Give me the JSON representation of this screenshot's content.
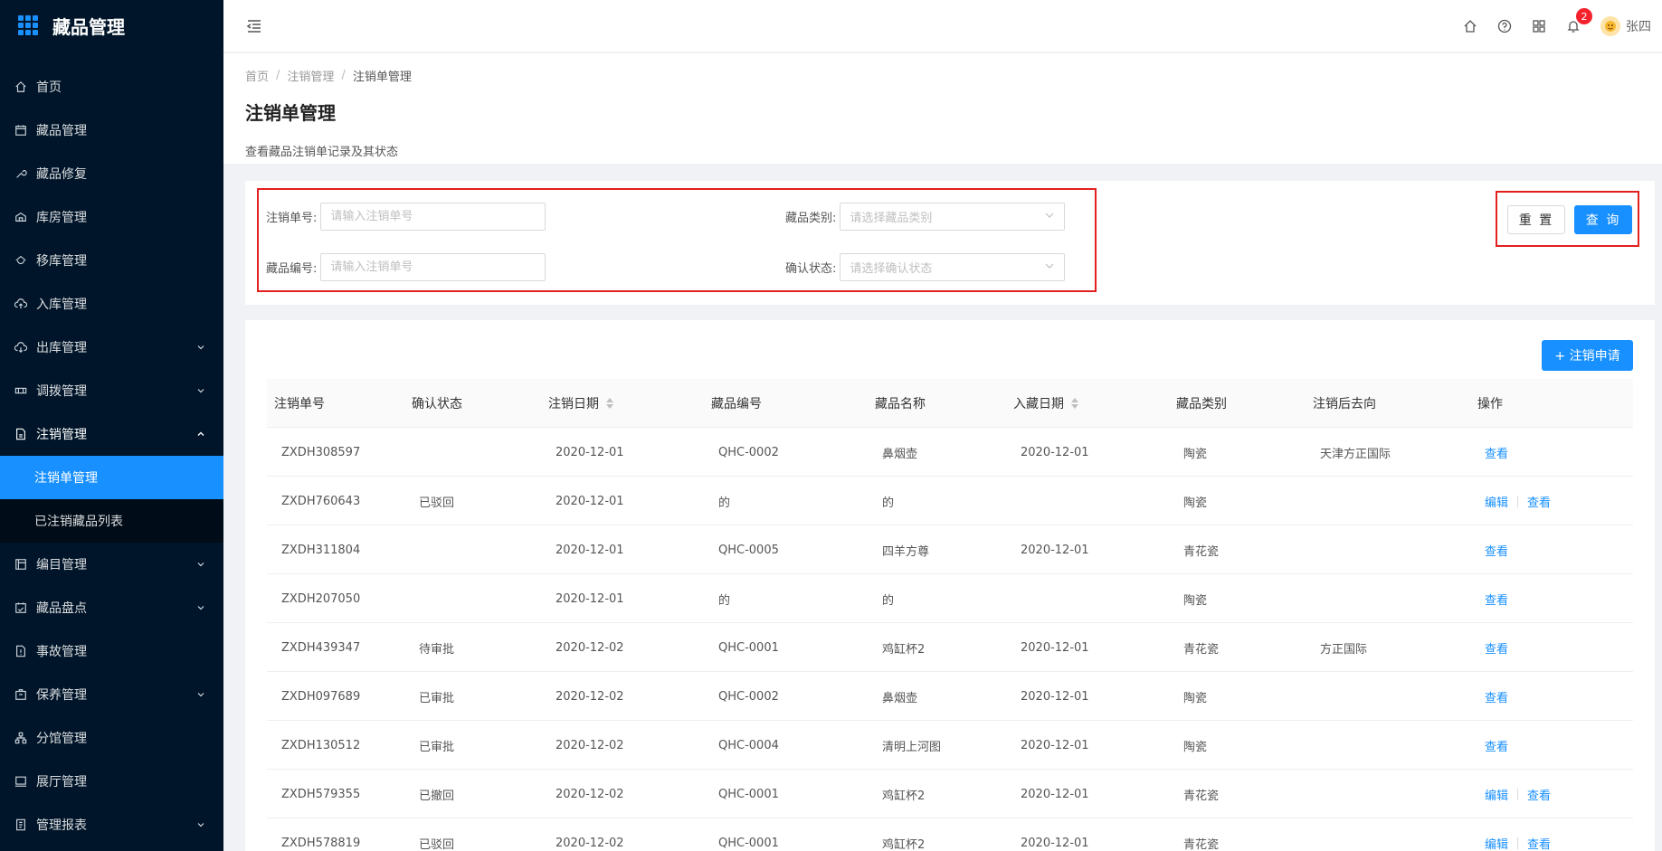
{
  "app": {
    "title": "藏品管理"
  },
  "sidebar": {
    "items": [
      {
        "label": "首页",
        "icon": "home-icon"
      },
      {
        "label": "藏品管理",
        "icon": "calendar-icon"
      },
      {
        "label": "藏品修复",
        "icon": "wrench-icon"
      },
      {
        "label": "库房管理",
        "icon": "warehouse-icon"
      },
      {
        "label": "移库管理",
        "icon": "move-icon"
      },
      {
        "label": "入库管理",
        "icon": "cloud-upload-icon"
      },
      {
        "label": "出库管理",
        "icon": "cloud-download-icon"
      },
      {
        "label": "调拨管理",
        "icon": "transfer-icon"
      },
      {
        "label": "注销管理",
        "icon": "file-icon"
      },
      {
        "label": "注销单管理",
        "icon": ""
      },
      {
        "label": "已注销藏品列表",
        "icon": ""
      },
      {
        "label": "编目管理",
        "icon": "catalog-icon"
      },
      {
        "label": "藏品盘点",
        "icon": "inventory-icon"
      },
      {
        "label": "事故管理",
        "icon": "incident-icon"
      },
      {
        "label": "保养管理",
        "icon": "maintenance-icon"
      },
      {
        "label": "分馆管理",
        "icon": "branch-icon"
      },
      {
        "label": "展厅管理",
        "icon": "monitor-icon"
      },
      {
        "label": "管理报表",
        "icon": "report-icon"
      }
    ]
  },
  "header": {
    "notification_count": "2",
    "user_name": "张四"
  },
  "breadcrumb": [
    "首页",
    "注销管理",
    "注销单管理"
  ],
  "page": {
    "title": "注销单管理",
    "description": "查看藏品注销单记录及其状态"
  },
  "search": {
    "order_no_label": "注销单号:",
    "order_no_placeholder": "请输入注销单号",
    "category_label": "藏品类别:",
    "category_placeholder": "请选择藏品类别",
    "item_no_label": "藏品编号:",
    "item_no_placeholder": "请输入注销单号",
    "status_label": "确认状态:",
    "status_placeholder": "请选择确认状态",
    "reset_label": "重 置",
    "query_label": "查 询"
  },
  "table": {
    "add_label": "+ 注销申请",
    "columns": [
      "注销单号",
      "确认状态",
      "注销日期",
      "藏品编号",
      "藏品名称",
      "入藏日期",
      "藏品类别",
      "注销后去向",
      "操作"
    ],
    "rows": [
      {
        "order_no": "ZXDH308597",
        "status": "",
        "date": "2020-12-01",
        "item_no": "QHC-0002",
        "name": "鼻烟壶",
        "entry_date": "2020-12-01",
        "category": "陶瓷",
        "destination": "天津方正国际",
        "edit": "",
        "view": "查看"
      },
      {
        "order_no": "ZXDH760643",
        "status": "已驳回",
        "date": "2020-12-01",
        "item_no": "的",
        "name": "的",
        "entry_date": "",
        "category": "陶瓷",
        "destination": "",
        "edit": "编辑",
        "view": "查看"
      },
      {
        "order_no": "ZXDH311804",
        "status": "",
        "date": "2020-12-01",
        "item_no": "QHC-0005",
        "name": "四羊方尊",
        "entry_date": "2020-12-01",
        "category": "青花瓷",
        "destination": "",
        "edit": "",
        "view": "查看"
      },
      {
        "order_no": "ZXDH207050",
        "status": "",
        "date": "2020-12-01",
        "item_no": "的",
        "name": "的",
        "entry_date": "",
        "category": "陶瓷",
        "destination": "",
        "edit": "",
        "view": "查看"
      },
      {
        "order_no": "ZXDH439347",
        "status": "待审批",
        "date": "2020-12-02",
        "item_no": "QHC-0001",
        "name": "鸡缸杯2",
        "entry_date": "2020-12-01",
        "category": "青花瓷",
        "destination": "方正国际",
        "edit": "",
        "view": "查看"
      },
      {
        "order_no": "ZXDH097689",
        "status": "已审批",
        "date": "2020-12-02",
        "item_no": "QHC-0002",
        "name": "鼻烟壶",
        "entry_date": "2020-12-01",
        "category": "陶瓷",
        "destination": "",
        "edit": "",
        "view": "查看"
      },
      {
        "order_no": "ZXDH130512",
        "status": "已审批",
        "date": "2020-12-02",
        "item_no": "QHC-0004",
        "name": "清明上河图",
        "entry_date": "2020-12-01",
        "category": "陶瓷",
        "destination": "",
        "edit": "",
        "view": "查看"
      },
      {
        "order_no": "ZXDH579355",
        "status": "已撤回",
        "date": "2020-12-02",
        "item_no": "QHC-0001",
        "name": "鸡缸杯2",
        "entry_date": "2020-12-01",
        "category": "青花瓷",
        "destination": "",
        "edit": "编辑",
        "view": "查看"
      },
      {
        "order_no": "ZXDH578819",
        "status": "已驳回",
        "date": "2020-12-02",
        "item_no": "QHC-0001",
        "name": "鸡缸杯2",
        "entry_date": "2020-12-01",
        "category": "青花瓷",
        "destination": "",
        "edit": "编辑",
        "view": "查看"
      }
    ]
  },
  "colors": {
    "sidebar_bg": "#001529",
    "submenu_bg": "#000c17",
    "primary": "#1890ff",
    "highlight_border": "#e32020",
    "badge": "#f5222d"
  }
}
